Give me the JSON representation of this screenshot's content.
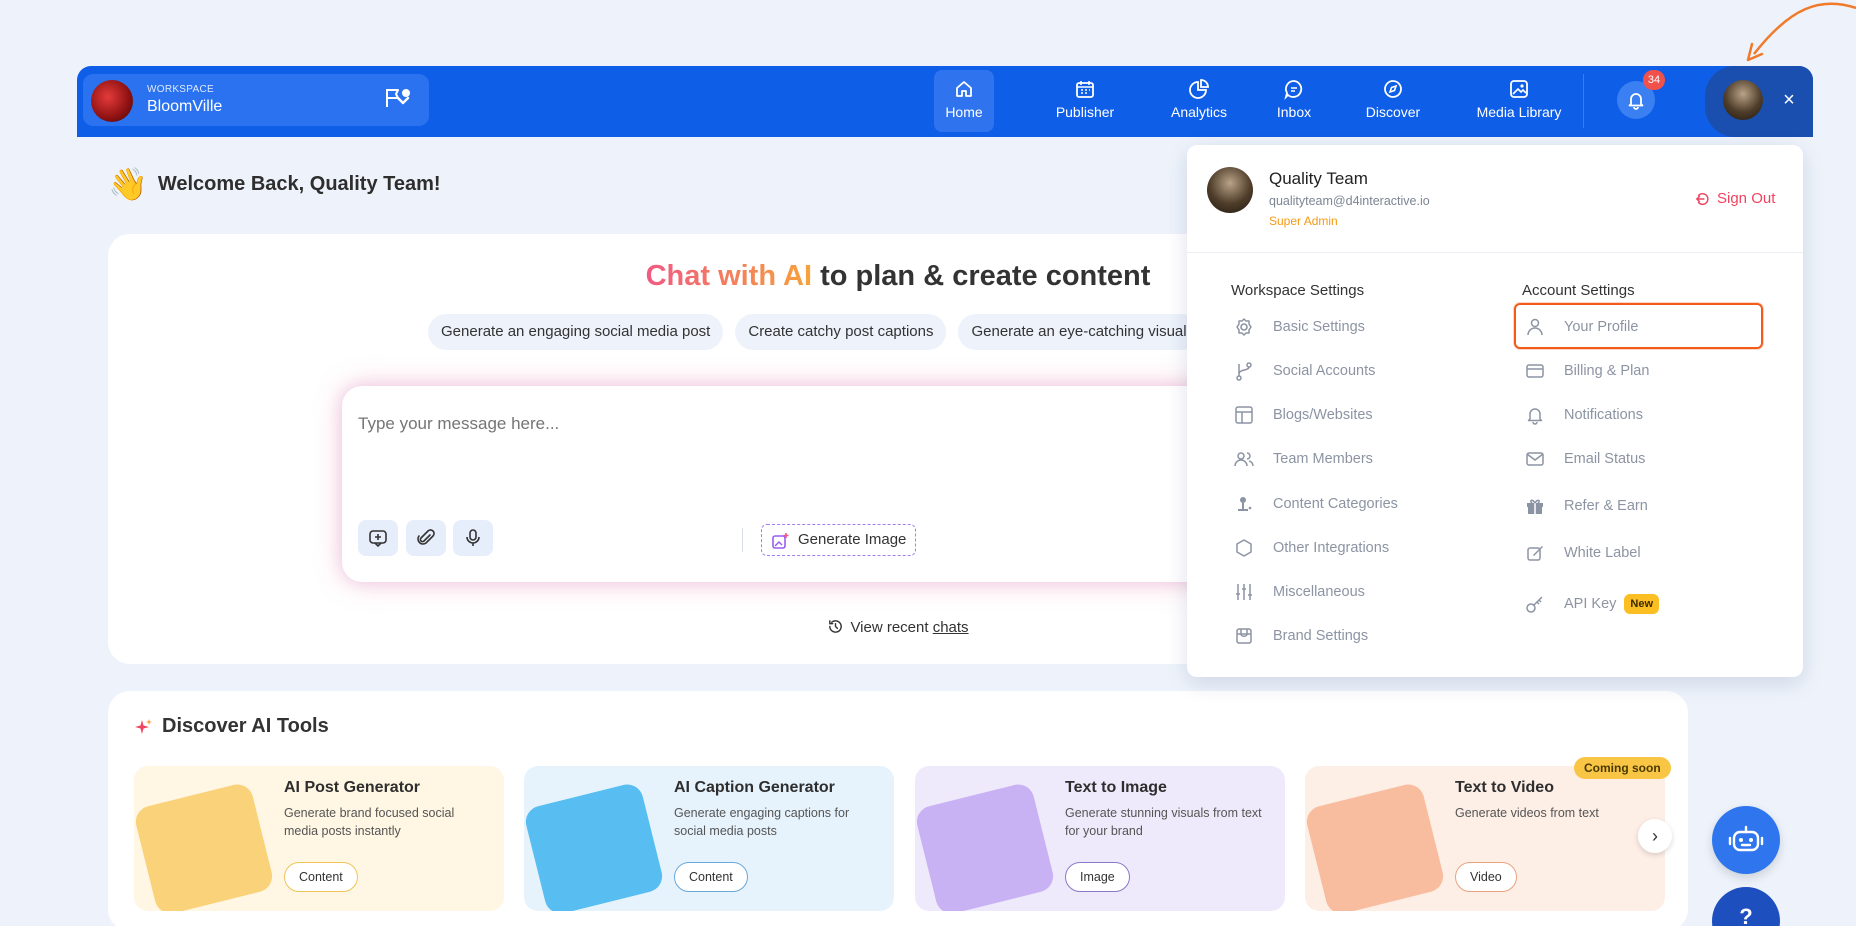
{
  "workspace": {
    "label": "WORKSPACE",
    "name": "BloomVille"
  },
  "nav": [
    {
      "label": "Home",
      "icon": "home-icon",
      "active": true
    },
    {
      "label": "Publisher",
      "icon": "calendar-icon"
    },
    {
      "label": "Analytics",
      "icon": "pie-chart-icon"
    },
    {
      "label": "Inbox",
      "icon": "chat-icon"
    },
    {
      "label": "Discover",
      "icon": "compass-icon"
    },
    {
      "label": "Media Library",
      "icon": "image-icon"
    }
  ],
  "notifications": {
    "count": "34"
  },
  "user_menu": {
    "close": "×"
  },
  "welcome": {
    "emoji": "👋",
    "text": "Welcome Back, Quality Team!"
  },
  "chat": {
    "title_highlight": "Chat with AI",
    "title_rest": " to plan & create content",
    "chips": [
      "Generate an engaging social media post",
      "Create catchy post captions",
      "Generate an eye-catching visual"
    ],
    "placeholder": "Type your message here...",
    "generate_image": "Generate Image",
    "recent_prefix": "View recent ",
    "recent_link": "chats"
  },
  "discover": {
    "title": "Discover AI Tools",
    "cards": [
      {
        "title": "AI Post Generator",
        "desc": "Generate brand focused social media posts instantly",
        "tag": "Content",
        "bg": "#fff6e3",
        "art": "#f9d27a"
      },
      {
        "title": "AI Caption Generator",
        "desc": "Generate engaging captions for social media posts",
        "tag": "Content",
        "bg": "#e6f3fd",
        "art": "#58bdf0"
      },
      {
        "title": "Text to Image",
        "desc": "Generate stunning visuals from text for your brand",
        "tag": "Image",
        "bg": "#efeafb",
        "art": "#c9b2f4"
      },
      {
        "title": "Text to Video",
        "desc": "Generate videos from text",
        "tag": "Video",
        "bg": "#fdeee6",
        "art": "#f8bd9e"
      }
    ],
    "coming_soon": "Coming soon",
    "next": "›"
  },
  "profile": {
    "name": "Quality Team",
    "email": "qualityteam@d4interactive.io",
    "role": "Super Admin",
    "sign_out": "Sign Out",
    "workspace_heading": "Workspace Settings",
    "account_heading": "Account Settings",
    "workspace_items": [
      {
        "label": "Basic Settings",
        "icon": "gear-icon"
      },
      {
        "label": "Social Accounts",
        "icon": "share-icon"
      },
      {
        "label": "Blogs/Websites",
        "icon": "layout-icon"
      },
      {
        "label": "Team Members",
        "icon": "users-icon"
      },
      {
        "label": "Content Categories",
        "icon": "category-icon"
      },
      {
        "label": "Other Integrations",
        "icon": "hexagon-icon"
      },
      {
        "label": "Miscellaneous",
        "icon": "sliders-icon"
      },
      {
        "label": "Brand Settings",
        "icon": "store-icon"
      }
    ],
    "account_items": [
      {
        "label": "Your Profile",
        "icon": "user-icon"
      },
      {
        "label": "Billing & Plan",
        "icon": "credit-card-icon"
      },
      {
        "label": "Notifications",
        "icon": "bell-icon"
      },
      {
        "label": "Email Status",
        "icon": "mail-icon"
      },
      {
        "label": "Refer & Earn",
        "icon": "gift-icon"
      },
      {
        "label": "White Label",
        "icon": "edit-icon"
      },
      {
        "label": "API Key",
        "icon": "key-icon",
        "badge": "New"
      }
    ]
  },
  "help": {
    "label": "?"
  }
}
